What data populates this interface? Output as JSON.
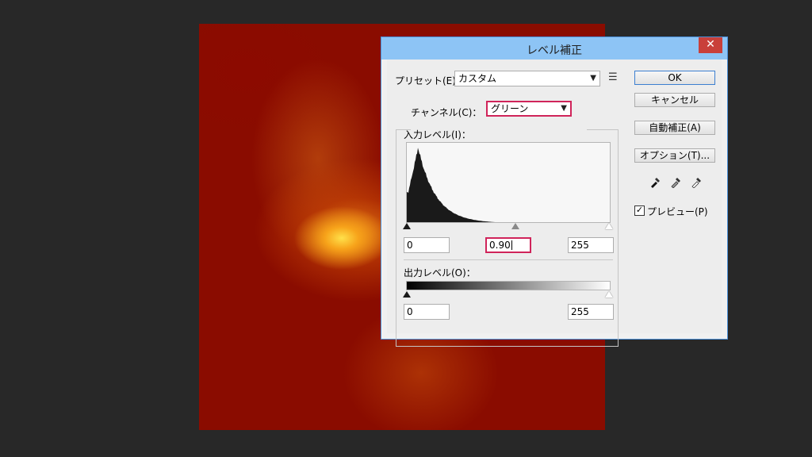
{
  "dialog": {
    "title": "レベル補正",
    "close_glyph": "✕"
  },
  "preset": {
    "label": "プリセット(E)：",
    "value": "カスタム",
    "menu_icon": "list-options-icon"
  },
  "channel": {
    "label": "チャンネル(C)：",
    "value": "グリーン"
  },
  "input_levels": {
    "label": "入力レベル(I)：",
    "black": "0",
    "gamma": "0.90",
    "white": "255"
  },
  "output_levels": {
    "label": "出力レベル(O)：",
    "black": "0",
    "white": "255"
  },
  "buttons": {
    "ok": "OK",
    "cancel": "キャンセル",
    "auto": "自動補正(A)",
    "options": "オプション(T)..."
  },
  "preview": {
    "label": "プレビュー(P)",
    "checked": true,
    "check_glyph": "✓"
  },
  "eyedroppers": [
    "black-eyedropper-icon",
    "gray-eyedropper-icon",
    "white-eyedropper-icon"
  ],
  "colors": {
    "title_bar": "#8dc4f5",
    "close_button": "#c9403a",
    "highlight_border": "#d0245a",
    "canvas_red": "#8a0c00"
  }
}
